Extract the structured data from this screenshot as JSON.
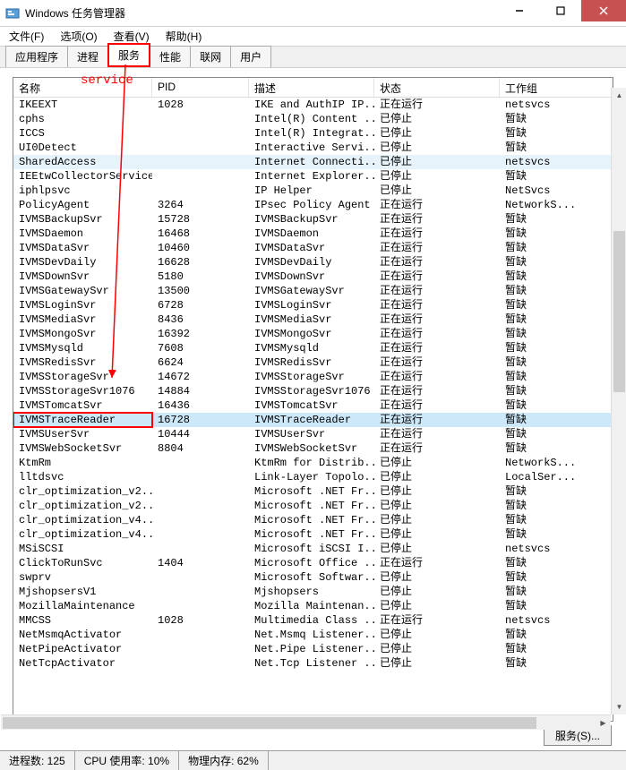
{
  "window": {
    "title": "Windows 任务管理器"
  },
  "menu": {
    "file": "文件(F)",
    "options": "选项(O)",
    "view": "查看(V)",
    "help": "帮助(H)"
  },
  "tabs": [
    "应用程序",
    "进程",
    "服务",
    "性能",
    "联网",
    "用户"
  ],
  "active_tab_index": 2,
  "annotation": "service",
  "columns": [
    "名称",
    "PID",
    "描述",
    "状态",
    "工作组"
  ],
  "rows": [
    {
      "name": "IKEEXT",
      "pid": "1028",
      "desc": "IKE and AuthIP IP...",
      "status": "正在运行",
      "group": "netsvcs"
    },
    {
      "name": "cphs",
      "pid": "",
      "desc": "Intel(R) Content ...",
      "status": "已停止",
      "group": "暂缺"
    },
    {
      "name": "ICCS",
      "pid": "",
      "desc": "Intel(R) Integrat...",
      "status": "已停止",
      "group": "暂缺"
    },
    {
      "name": "UI0Detect",
      "pid": "",
      "desc": "Interactive Servi...",
      "status": "已停止",
      "group": "暂缺"
    },
    {
      "name": "SharedAccess",
      "pid": "",
      "desc": "Internet Connecti...",
      "status": "已停止",
      "group": "netsvcs",
      "hl": 1
    },
    {
      "name": "IEEtwCollectorService",
      "pid": "",
      "desc": "Internet Explorer...",
      "status": "已停止",
      "group": "暂缺"
    },
    {
      "name": "iphlpsvc",
      "pid": "",
      "desc": "IP Helper",
      "status": "已停止",
      "group": "NetSvcs"
    },
    {
      "name": "PolicyAgent",
      "pid": "3264",
      "desc": "IPsec Policy Agent",
      "status": "正在运行",
      "group": "NetworkS..."
    },
    {
      "name": "IVMSBackupSvr",
      "pid": "15728",
      "desc": "IVMSBackupSvr",
      "status": "正在运行",
      "group": "暂缺"
    },
    {
      "name": "IVMSDaemon",
      "pid": "16468",
      "desc": "IVMSDaemon",
      "status": "正在运行",
      "group": "暂缺"
    },
    {
      "name": "IVMSDataSvr",
      "pid": "10460",
      "desc": "IVMSDataSvr",
      "status": "正在运行",
      "group": "暂缺"
    },
    {
      "name": "IVMSDevDaily",
      "pid": "16628",
      "desc": "IVMSDevDaily",
      "status": "正在运行",
      "group": "暂缺"
    },
    {
      "name": "IVMSDownSvr",
      "pid": "5180",
      "desc": "IVMSDownSvr",
      "status": "正在运行",
      "group": "暂缺"
    },
    {
      "name": "IVMSGatewaySvr",
      "pid": "13500",
      "desc": "IVMSGatewaySvr",
      "status": "正在运行",
      "group": "暂缺"
    },
    {
      "name": "IVMSLoginSvr",
      "pid": "6728",
      "desc": "IVMSLoginSvr",
      "status": "正在运行",
      "group": "暂缺"
    },
    {
      "name": "IVMSMediaSvr",
      "pid": "8436",
      "desc": "IVMSMediaSvr",
      "status": "正在运行",
      "group": "暂缺"
    },
    {
      "name": "IVMSMongoSvr",
      "pid": "16392",
      "desc": "IVMSMongoSvr",
      "status": "正在运行",
      "group": "暂缺"
    },
    {
      "name": "IVMSMysqld",
      "pid": "7608",
      "desc": "IVMSMysqld",
      "status": "正在运行",
      "group": "暂缺"
    },
    {
      "name": "IVMSRedisSvr",
      "pid": "6624",
      "desc": "IVMSRedisSvr",
      "status": "正在运行",
      "group": "暂缺"
    },
    {
      "name": "IVMSStorageSvr",
      "pid": "14672",
      "desc": "IVMSStorageSvr",
      "status": "正在运行",
      "group": "暂缺"
    },
    {
      "name": "IVMSStorageSvr1076",
      "pid": "14884",
      "desc": "IVMSStorageSvr1076",
      "status": "正在运行",
      "group": "暂缺"
    },
    {
      "name": "IVMSTomcatSvr",
      "pid": "16436",
      "desc": "IVMSTomcatSvr",
      "status": "正在运行",
      "group": "暂缺"
    },
    {
      "name": "IVMSTraceReader",
      "pid": "16728",
      "desc": "IVMSTraceReader",
      "status": "正在运行",
      "group": "暂缺",
      "selected": true
    },
    {
      "name": "IVMSUserSvr",
      "pid": "10444",
      "desc": "IVMSUserSvr",
      "status": "正在运行",
      "group": "暂缺"
    },
    {
      "name": "IVMSWebSocketSvr",
      "pid": "8804",
      "desc": "IVMSWebSocketSvr",
      "status": "正在运行",
      "group": "暂缺"
    },
    {
      "name": "KtmRm",
      "pid": "",
      "desc": "KtmRm for Distrib...",
      "status": "已停止",
      "group": "NetworkS..."
    },
    {
      "name": "lltdsvc",
      "pid": "",
      "desc": "Link-Layer Topolo...",
      "status": "已停止",
      "group": "LocalSer..."
    },
    {
      "name": "clr_optimization_v2...",
      "pid": "",
      "desc": "Microsoft .NET Fr...",
      "status": "已停止",
      "group": "暂缺"
    },
    {
      "name": "clr_optimization_v2...",
      "pid": "",
      "desc": "Microsoft .NET Fr...",
      "status": "已停止",
      "group": "暂缺"
    },
    {
      "name": "clr_optimization_v4...",
      "pid": "",
      "desc": "Microsoft .NET Fr...",
      "status": "已停止",
      "group": "暂缺"
    },
    {
      "name": "clr_optimization_v4...",
      "pid": "",
      "desc": "Microsoft .NET Fr...",
      "status": "已停止",
      "group": "暂缺"
    },
    {
      "name": "MSiSCSI",
      "pid": "",
      "desc": "Microsoft iSCSI I...",
      "status": "已停止",
      "group": "netsvcs"
    },
    {
      "name": "ClickToRunSvc",
      "pid": "1404",
      "desc": "Microsoft Office ...",
      "status": "正在运行",
      "group": "暂缺"
    },
    {
      "name": "swprv",
      "pid": "",
      "desc": "Microsoft Softwar...",
      "status": "已停止",
      "group": "暂缺"
    },
    {
      "name": "MjshopsersV1",
      "pid": "",
      "desc": "Mjshopsers",
      "status": "已停止",
      "group": "暂缺"
    },
    {
      "name": "MozillaMaintenance",
      "pid": "",
      "desc": "Mozilla Maintenan...",
      "status": "已停止",
      "group": "暂缺"
    },
    {
      "name": "MMCSS",
      "pid": "1028",
      "desc": "Multimedia Class ...",
      "status": "正在运行",
      "group": "netsvcs"
    },
    {
      "name": "NetMsmqActivator",
      "pid": "",
      "desc": "Net.Msmq Listener...",
      "status": "已停止",
      "group": "暂缺"
    },
    {
      "name": "NetPipeActivator",
      "pid": "",
      "desc": "Net.Pipe Listener...",
      "status": "已停止",
      "group": "暂缺"
    },
    {
      "name": "NetTcpActivator",
      "pid": "",
      "desc": "Net.Tcp Listener ...",
      "status": "已停止",
      "group": "暂缺"
    }
  ],
  "button": {
    "services": "服务(S)..."
  },
  "status": {
    "procs": "进程数: 125",
    "cpu": "CPU 使用率: 10%",
    "mem": "物理内存: 62%"
  }
}
